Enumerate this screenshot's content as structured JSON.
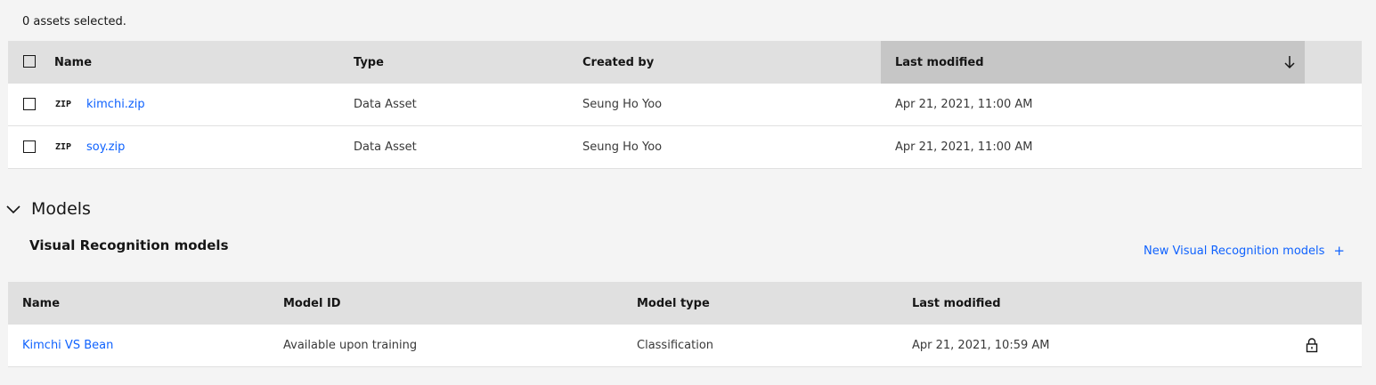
{
  "assets": {
    "selected_count": "0 assets selected.",
    "columns": {
      "name": "Name",
      "type": "Type",
      "created_by": "Created by",
      "last_modified": "Last modified"
    },
    "sort": {
      "column": "Last modified",
      "direction": "descending"
    },
    "rows": [
      {
        "tag": "ZIP",
        "name": "kimchi.zip",
        "type": "Data Asset",
        "created_by": "Seung Ho Yoo",
        "last_modified": "Apr 21, 2021, 11:00 AM"
      },
      {
        "tag": "ZIP",
        "name": "soy.zip",
        "type": "Data Asset",
        "created_by": "Seung Ho Yoo",
        "last_modified": "Apr 21, 2021, 11:00 AM"
      }
    ]
  },
  "models": {
    "section_title": "Models",
    "subsection_title": "Visual Recognition models",
    "new_button_label": "New Visual Recognition models",
    "new_button_icon": "plus-icon",
    "columns": {
      "name": "Name",
      "model_id": "Model ID",
      "model_type": "Model type",
      "last_modified": "Last modified"
    },
    "rows": [
      {
        "name": "Kimchi VS Bean",
        "model_id": "Available upon training",
        "model_type": "Classification",
        "last_modified": "Apr 21, 2021, 10:59 AM",
        "icon": "lock-icon"
      }
    ]
  },
  "colors": {
    "link": "#0f62fe",
    "header_bg": "#e0e0e0",
    "sorted_header_bg": "#c6c6c6",
    "page_bg": "#f4f4f4"
  }
}
